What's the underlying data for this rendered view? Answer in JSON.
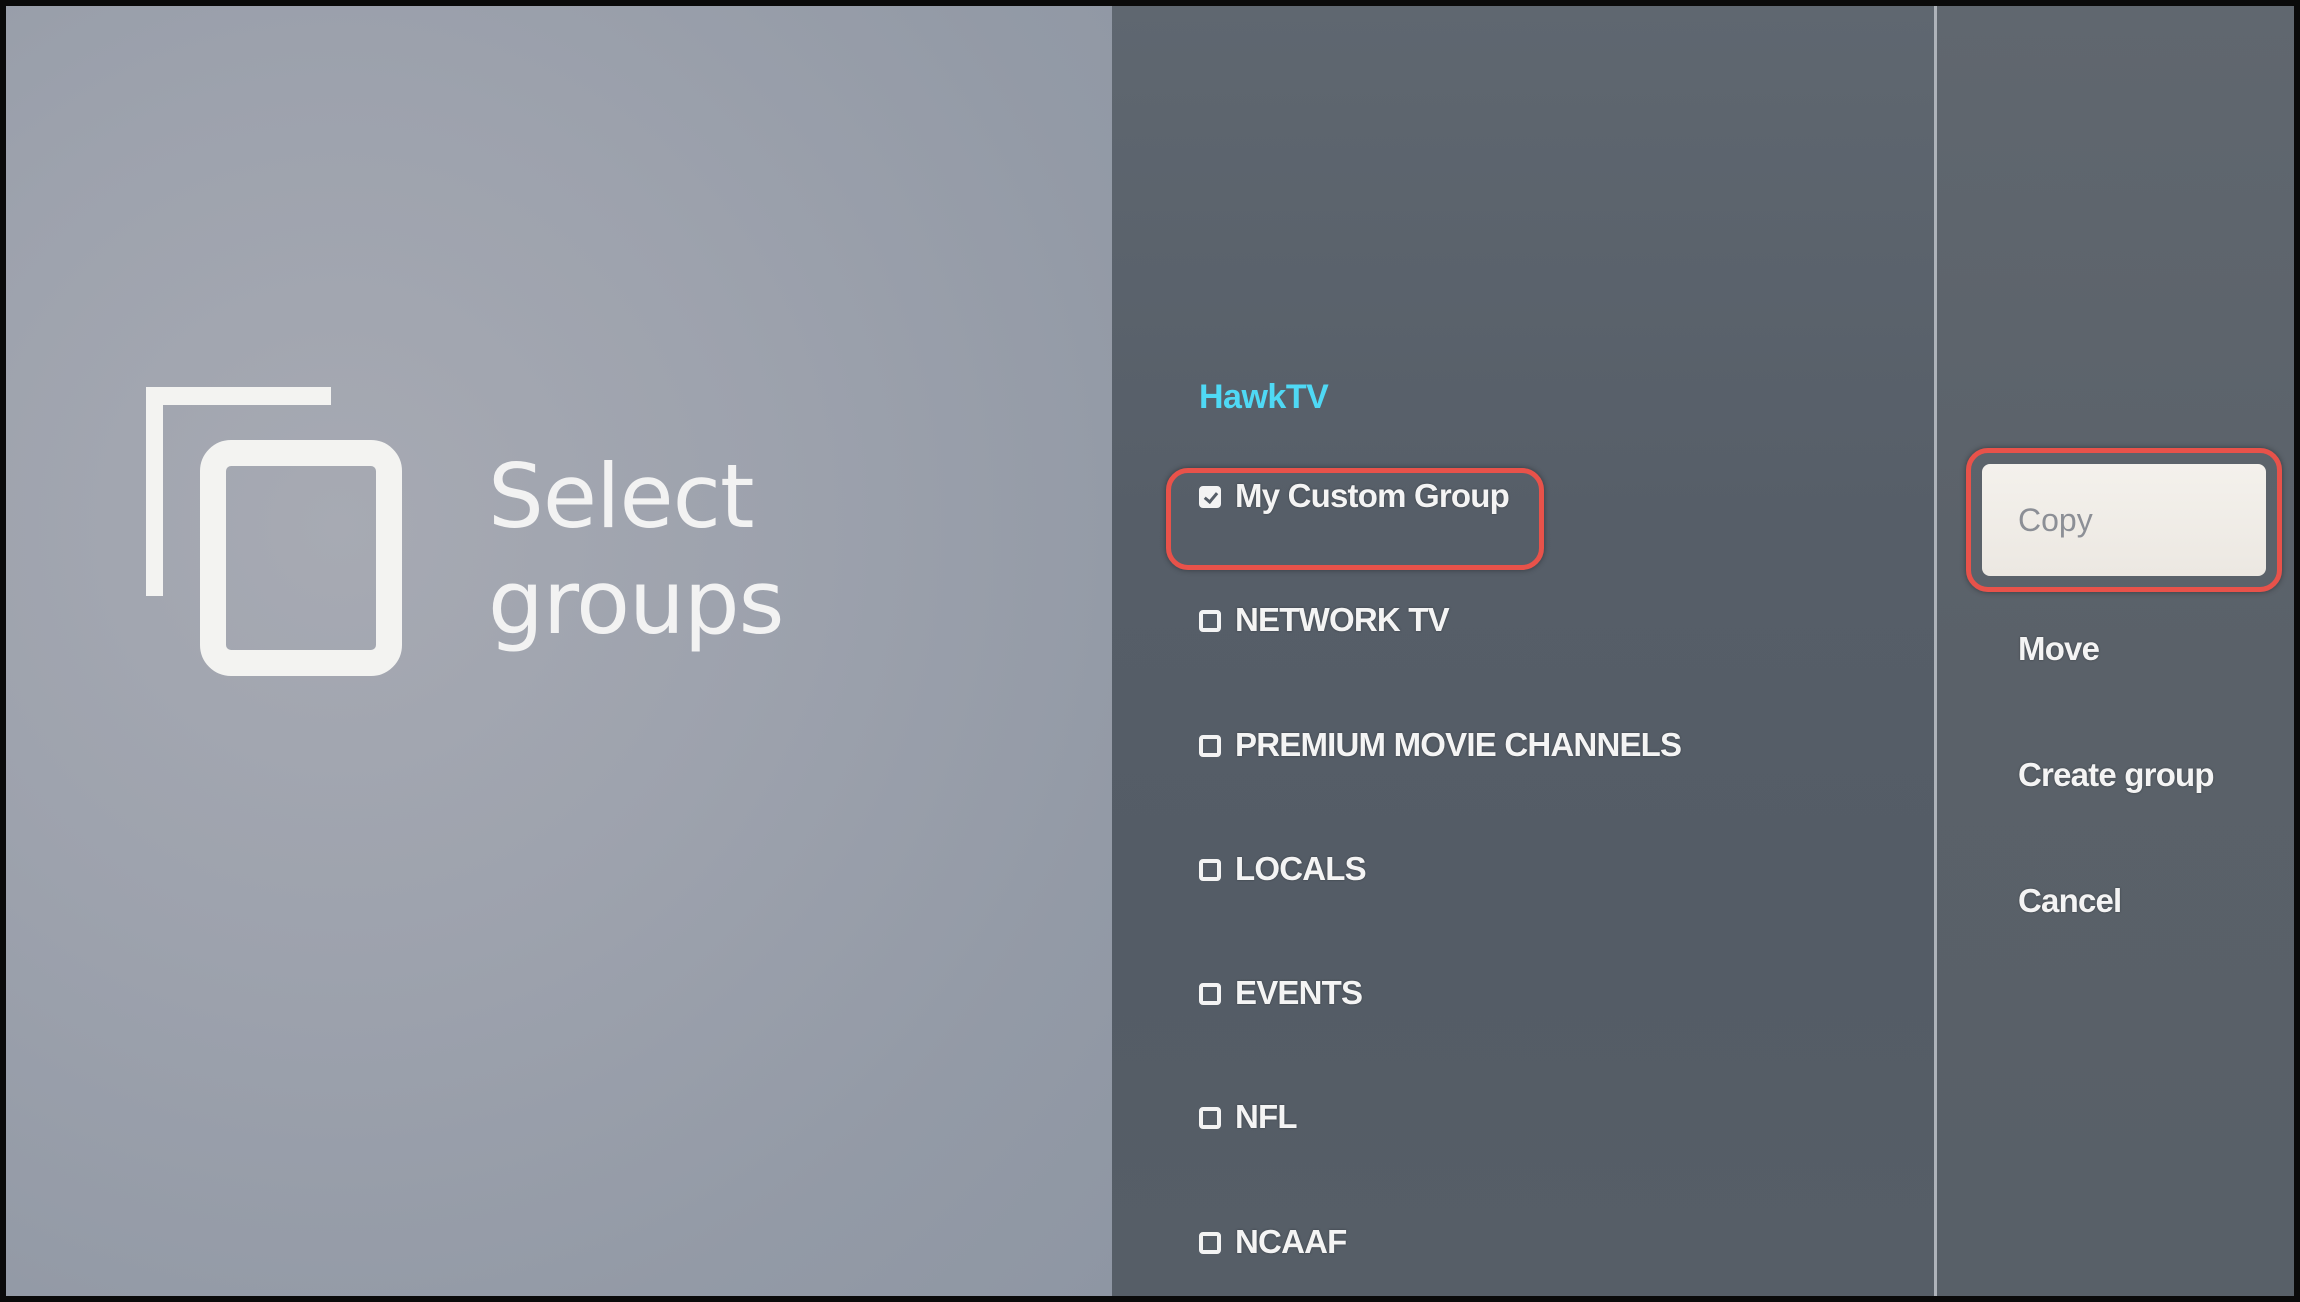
{
  "dialog": {
    "title": "Select\ngroups",
    "icon": "copy-icon"
  },
  "app": {
    "name": "HawkTV"
  },
  "groups": [
    {
      "label": "My Custom Group",
      "checked": true
    },
    {
      "label": "NETWORK TV",
      "checked": false
    },
    {
      "label": "PREMIUM MOVIE CHANNELS",
      "checked": false
    },
    {
      "label": "LOCALS",
      "checked": false
    },
    {
      "label": "EVENTS",
      "checked": false
    },
    {
      "label": "NFL",
      "checked": false
    },
    {
      "label": "NCAAF",
      "checked": false
    }
  ],
  "actions": [
    {
      "label": "Copy",
      "focused": true
    },
    {
      "label": "Move",
      "focused": false
    },
    {
      "label": "Create group",
      "focused": false
    },
    {
      "label": "Cancel",
      "focused": false
    }
  ],
  "colors": {
    "app_name": "#4fd9f5",
    "annotation": "#e8524a",
    "focused_button": "#f4f1ec"
  }
}
